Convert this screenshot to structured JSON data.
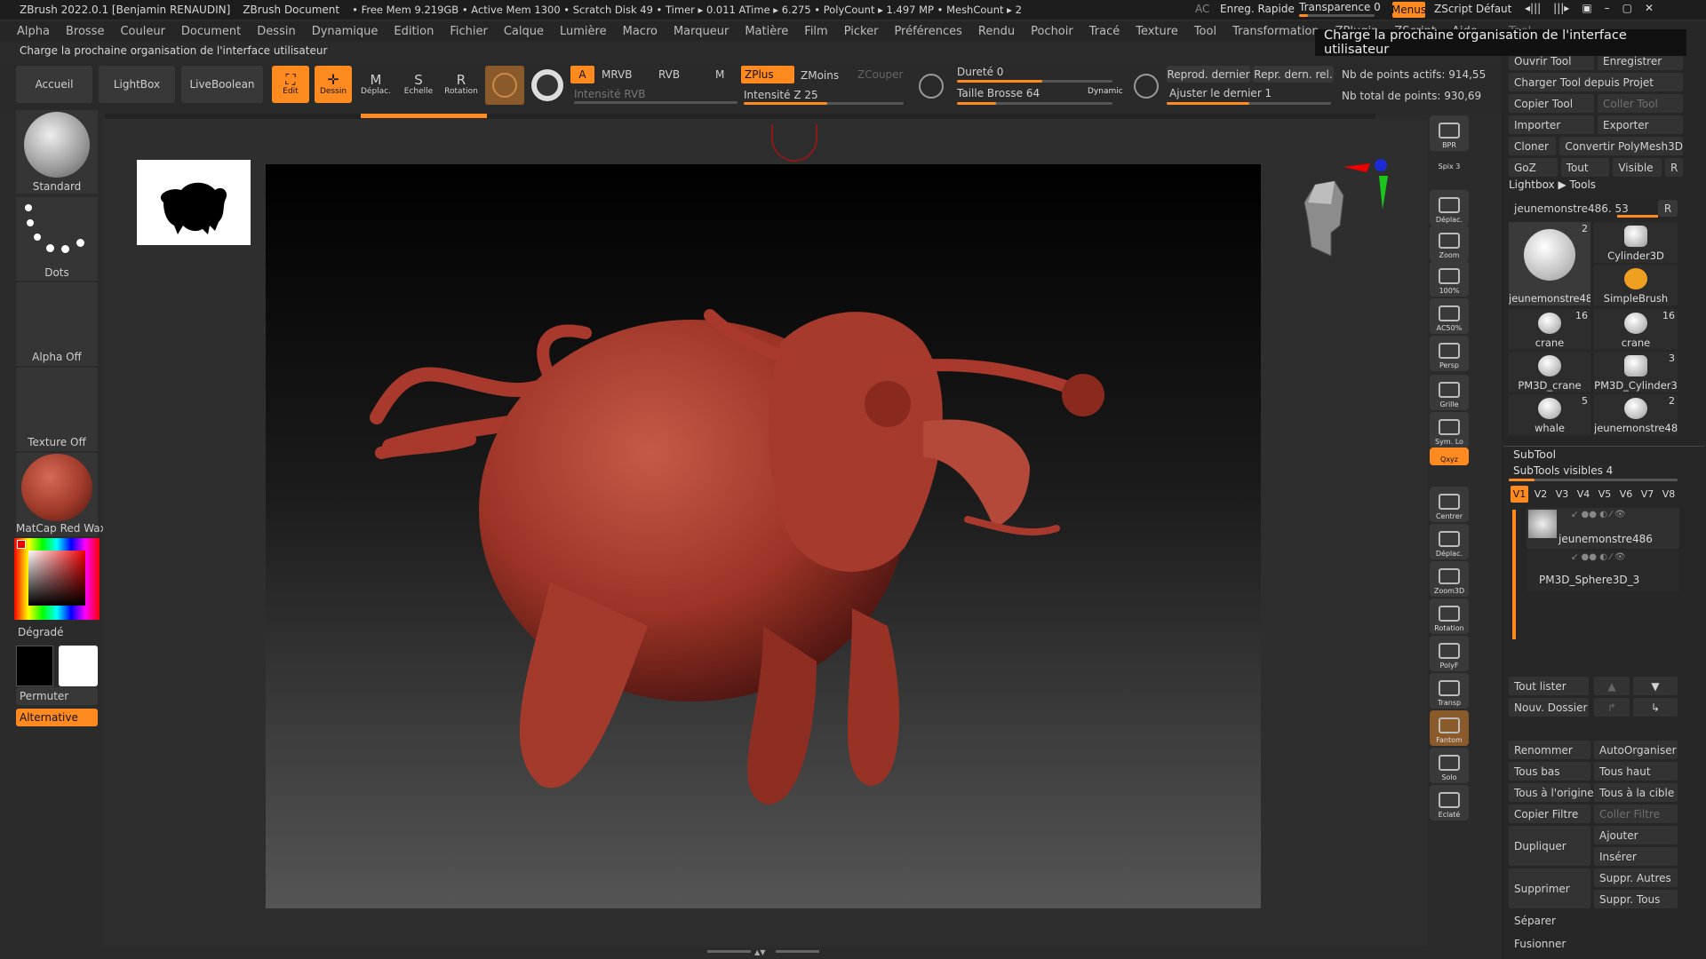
{
  "titlebar": {
    "app": "ZBrush 2022.0.1 [Benjamin RENAUDIN]",
    "doc": "ZBrush Document",
    "stats": "• Free Mem 9.219GB • Active Mem 1300 • Scratch Disk 49 • Timer ▸ 0.011 ATime ▸ 6.275 • PolyCount ▸ 1.497 MP  • MeshCount ▸ 2",
    "ac": "AC",
    "quicksave": "Enreg. Rapide",
    "transparency": "Transparence 0",
    "menus": "Menus",
    "zscript": "ZScript Défaut"
  },
  "menus": [
    "Alpha",
    "Brosse",
    "Couleur",
    "Document",
    "Dessin",
    "Dynamique",
    "Edition",
    "Fichier",
    "Calque",
    "Lumière",
    "Macro",
    "Marqueur",
    "Matière",
    "Film",
    "Picker",
    "Préférences",
    "Rendu",
    "Pochoir",
    "Tracé",
    "Texture",
    "Tool",
    "Transformation",
    "ZPlugin",
    "ZScript",
    "Aide"
  ],
  "note": "Charge la prochaine organisation de l'interface utilisateur",
  "tooltip": "Charge la prochaine organisation de l'interface utilisateur",
  "toolbar": {
    "accueil": "Accueil",
    "lightbox": "LightBox",
    "liveboolean": "LiveBoolean",
    "edit": "Edit",
    "dessin": "Dessin",
    "deplac": "Déplac.",
    "echelle": "Echelle",
    "rotation": "Rotation",
    "a": "A",
    "mrvb": "MRVB",
    "rvb": "RVB",
    "m": "M",
    "intensite_rvb": "Intensité RVB",
    "zplus": "ZPlus",
    "zmoins": "ZMoins",
    "zcouper": "ZCouper",
    "intensite_z": "Intensité Z 25",
    "durete": "Dureté 0",
    "taille": "Taille Brosse 64",
    "dynamic": "Dynamic",
    "repro": "Reprod. dernier",
    "repr_rel": "Repr. dern. rel.",
    "ajuster": "Ajuster le dernier 1",
    "pts_actifs": "Nb de points actifs: 914,55",
    "pts_total": "Nb total de points: 930,69"
  },
  "left": {
    "brush": "Standard",
    "stroke": "Dots",
    "alpha": "Alpha Off",
    "texture": "Texture Off",
    "material": "MatCap Red Wax",
    "gradient": "Dégradé",
    "switch": "Permuter",
    "alternative": "Alternative"
  },
  "rightbar": [
    {
      "name": "bpr",
      "label": "BPR"
    },
    {
      "name": "spix",
      "label": "Spix 3"
    },
    {
      "name": "deplac",
      "label": "Déplac."
    },
    {
      "name": "zoom",
      "label": "Zoom"
    },
    {
      "name": "100",
      "label": "100%"
    },
    {
      "name": "ac50",
      "label": "AC50%"
    },
    {
      "name": "persp",
      "label": "Persp"
    },
    {
      "name": "grille",
      "label": "Grille"
    },
    {
      "name": "sym",
      "label": "Sym. Lo"
    },
    {
      "name": "xyz",
      "label": "Qxyz"
    },
    {
      "name": "centrer",
      "label": "Centrer"
    },
    {
      "name": "deplac2",
      "label": "Déplac."
    },
    {
      "name": "zoom3d",
      "label": "Zoom3D"
    },
    {
      "name": "rotation",
      "label": "Rotation"
    },
    {
      "name": "polyf",
      "label": "PolyF"
    },
    {
      "name": "transp",
      "label": "Transp"
    },
    {
      "name": "fantom",
      "label": "Fantom"
    },
    {
      "name": "solo",
      "label": "Solo"
    },
    {
      "name": "eclate",
      "label": "Eclaté"
    }
  ],
  "tool": {
    "header": "Tool",
    "rows": [
      [
        "Ouvrir Tool",
        "Enregistrer"
      ],
      [
        "Charger Tool depuis Projet"
      ],
      [
        "Copier Tool",
        "Coller Tool"
      ],
      [
        "Importer",
        "Exporter"
      ],
      [
        "Cloner",
        "Convertir PolyMesh3D"
      ],
      [
        "GoZ",
        "Tout",
        "Visible",
        "R"
      ]
    ],
    "lightbox_tools": "Lightbox ▶ Tools",
    "current": "jeunemonstre486. 53",
    "current_r": "R",
    "thumbs": [
      {
        "label": "jeunemonstre48",
        "count": "2"
      },
      {
        "label": "Cylinder3D",
        "count": ""
      },
      {
        "label": "SimpleBrush",
        "count": ""
      },
      {
        "label": "crane",
        "count": "16"
      },
      {
        "label": "crane",
        "count": "16"
      },
      {
        "label": "PM3D_crane",
        "count": ""
      },
      {
        "label": "PM3D_Cylinder3",
        "count": "3"
      },
      {
        "label": "whale",
        "count": "5"
      },
      {
        "label": "jeunemonstre48",
        "count": "2"
      }
    ]
  },
  "subtool": {
    "header": "SubTool",
    "visible": "SubTools visibles 4",
    "versions": [
      "V1",
      "V2",
      "V3",
      "V4",
      "V5",
      "V6",
      "V7",
      "V8"
    ],
    "items": [
      "jeunemonstre486",
      "PM3D_Sphere3D_3"
    ],
    "buttons": {
      "tout_lister": "Tout lister",
      "nouv_dossier": "Nouv. Dossier",
      "renommer": "Renommer",
      "autoorganiser": "AutoOrganiser",
      "tous_bas": "Tous bas",
      "tous_haut": "Tous haut",
      "tous_origine": "Tous à l'origine",
      "tous_cible": "Tous à la cible",
      "copier_filtre": "Copier Filtre",
      "coller_filtre": "Coller Filtre",
      "dupliquer": "Dupliquer",
      "ajouter": "Ajouter",
      "inserer": "Insérer",
      "supprimer": "Supprimer",
      "suppr_autres": "Suppr. Autres",
      "suppr_tous": "Suppr. Tous",
      "separer": "Séparer",
      "fusionner": "Fusionner"
    }
  },
  "colors": {
    "accent": "#ff8a1f",
    "bg": "#2b2b2b",
    "model": "#a8392c"
  }
}
